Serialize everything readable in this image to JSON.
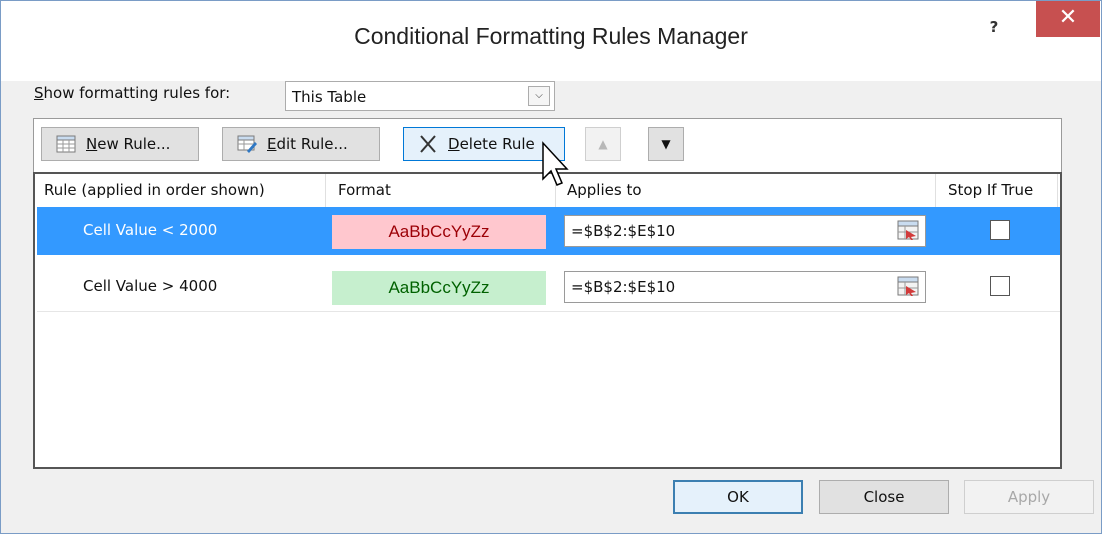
{
  "window": {
    "title": "Conditional Formatting Rules Manager",
    "help_label": "?",
    "close_label": "✕"
  },
  "show_rules": {
    "label_underlined": "S",
    "label_rest": "how formatting rules for:",
    "selected": "This Table",
    "arrow": "⌵"
  },
  "toolbar": {
    "new_rule": {
      "underlined": "N",
      "rest": "ew Rule..."
    },
    "edit_rule": {
      "underlined": "E",
      "rest": "dit Rule..."
    },
    "delete_rule": {
      "underlined": "D",
      "rest": "elete Rule"
    },
    "move_up": "▲",
    "move_down": "▼"
  },
  "columns": {
    "rule": "Rule (applied in order shown)",
    "format": "Format",
    "applies_to": "Applies to",
    "stop_if_true": "Stop If True"
  },
  "rules": [
    {
      "rule": "Cell Value < 2000",
      "format_preview": "AaBbCcYyZz",
      "format_fill": "#ffc7ce",
      "format_text": "#9c0006",
      "applies_to": "=$B$2:$E$10",
      "stop_if_true": false,
      "selected": true
    },
    {
      "rule": "Cell Value > 4000",
      "format_preview": "AaBbCcYyZz",
      "format_fill": "#c6efce",
      "format_text": "#006100",
      "applies_to": "=$B$2:$E$10",
      "stop_if_true": false,
      "selected": false
    }
  ],
  "footer": {
    "ok": "OK",
    "close": "Close",
    "apply": "Apply"
  },
  "colors": {
    "selection": "#3399ff",
    "close_button": "#c75050"
  }
}
